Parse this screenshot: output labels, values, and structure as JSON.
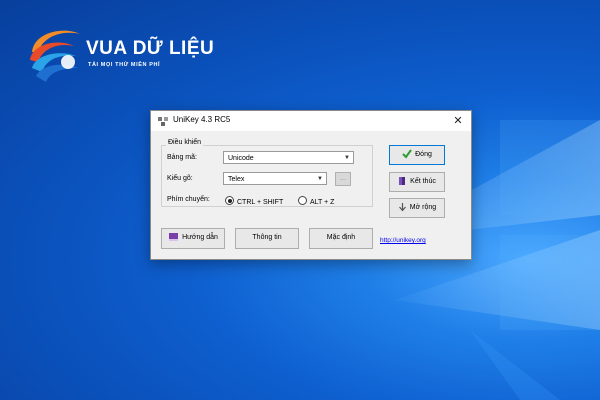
{
  "logo": {
    "title": "VUA DỮ LIỆU",
    "subtitle": "TẢI MỌI THỨ MIỄN PHÍ"
  },
  "window": {
    "title": "UniKey 4.3 RC5",
    "close_label": "✕",
    "group_label": "Điều khiển",
    "encoding_label": "Bảng mã:",
    "encoding_value": "Unicode",
    "typing_label": "Kiểu gõ:",
    "typing_value": "Telex",
    "small_button": "...",
    "switch_label": "Phím chuyển:",
    "switch_options": [
      {
        "label": "CTRL + SHIFT",
        "selected": true
      },
      {
        "label": "ALT + Z",
        "selected": false
      }
    ],
    "buttons": {
      "close": "Đóng",
      "exit": "Kết thúc",
      "expand": "Mở rộng",
      "help": "Hướng dẫn",
      "info": "Thông tin",
      "default": "Mặc định"
    },
    "link": "http://unikey.org"
  },
  "colors": {
    "accent": "#0078d7",
    "desktop": "#0e5fcf",
    "check": "#2e9b2e"
  }
}
